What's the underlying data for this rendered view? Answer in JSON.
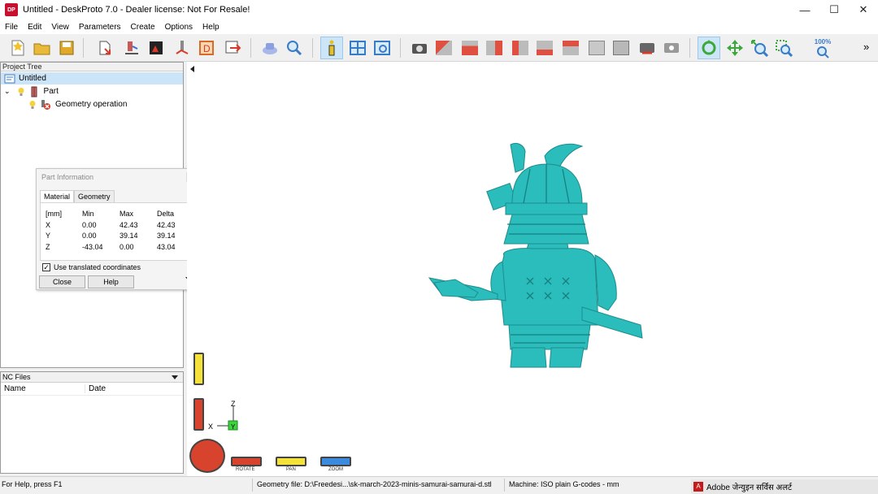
{
  "window": {
    "title": "Untitled - DeskProto 7.0 - Dealer license: Not For Resale!",
    "app_icon_text": "DP"
  },
  "window_controls": {
    "minimize": "—",
    "maximize": "☐",
    "close": "✕"
  },
  "menu": [
    "File",
    "Edit",
    "View",
    "Parameters",
    "Create",
    "Options",
    "Help"
  ],
  "toolbar": {
    "zoom_label": "100%",
    "overflow": "»"
  },
  "project_tree": {
    "header": "Project Tree",
    "items": [
      {
        "label": "Untitled"
      },
      {
        "label": "Part"
      },
      {
        "label": "Geometry operation"
      }
    ]
  },
  "nc_files": {
    "header": "NC Files",
    "columns": [
      "Name",
      "Date"
    ]
  },
  "part_information": {
    "title": "Part Information",
    "tabs": [
      "Material",
      "Geometry"
    ],
    "headers": [
      "[mm]",
      "Min",
      "Max",
      "Delta"
    ],
    "rows": [
      [
        "X",
        "0.00",
        "42.43",
        "42.43"
      ],
      [
        "Y",
        "0.00",
        "39.14",
        "39.14"
      ],
      [
        "Z",
        "-43.04",
        "0.00",
        "43.04"
      ]
    ],
    "checkbox_label": "Use translated coordinates",
    "checkbox_checked": true,
    "close_button": "Close",
    "help_button": "Help"
  },
  "viewport": {
    "axes": {
      "z": "Z",
      "x": "X",
      "y": "Y"
    },
    "controls": [
      "ROTATE",
      "PAN",
      "ZOOM"
    ]
  },
  "status": {
    "help": "For Help, press F1",
    "geometry_file": "Geometry file: D:\\Freedesi...\\sk-march-2023-minis-samurai-samurai-d.stl",
    "machine": "Machine: ISO plain G-codes - mm",
    "notification": "Adobe जेन्युइन सर्विस अलर्ट"
  },
  "colors": {
    "model": "#2bbcbc",
    "selection": "#cce4f7",
    "accent_red": "#d83a2a"
  }
}
